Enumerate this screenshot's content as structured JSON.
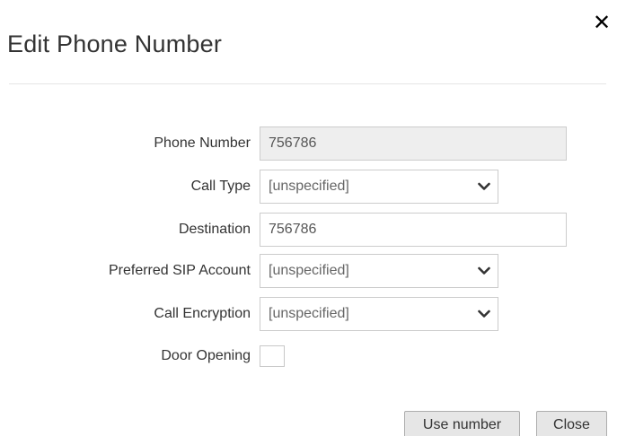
{
  "dialog": {
    "title": "Edit Phone Number",
    "close_icon": "close-icon"
  },
  "form": {
    "phone_number": {
      "label": "Phone Number",
      "value": "756786",
      "readonly": true
    },
    "call_type": {
      "label": "Call Type",
      "value": "[unspecified]"
    },
    "destination": {
      "label": "Destination",
      "value": "756786"
    },
    "preferred_sip_account": {
      "label": "Preferred SIP Account",
      "value": "[unspecified]"
    },
    "call_encryption": {
      "label": "Call Encryption",
      "value": "[unspecified]"
    },
    "door_opening": {
      "label": "Door Opening",
      "checked": false
    }
  },
  "footer": {
    "use_number_label": "Use number",
    "close_label": "Close"
  },
  "icons": {
    "dialog_close": "close-icon",
    "select_arrow": "chevron-down-icon"
  }
}
